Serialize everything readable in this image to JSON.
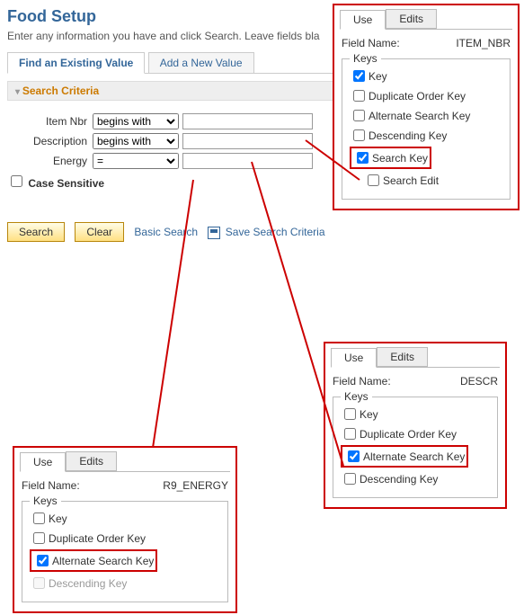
{
  "page": {
    "title": "Food Setup",
    "instruction": "Enter any information you have and click Search. Leave fields bla",
    "tabs": {
      "find": "Find an Existing Value",
      "add": "Add a New Value"
    },
    "section_bar": "Search Criteria",
    "fields": {
      "item_nbr": {
        "label": "Item Nbr",
        "op": "begins with",
        "value": ""
      },
      "description": {
        "label": "Description",
        "op": "begins with",
        "value": ""
      },
      "energy": {
        "label": "Energy",
        "op": "=",
        "value": ""
      }
    },
    "case_sensitive_label": "Case Sensitive",
    "buttons": {
      "search": "Search",
      "clear": "Clear"
    },
    "links": {
      "basic": "Basic Search",
      "save": "Save Search Criteria"
    }
  },
  "popup_common": {
    "tab_use": "Use",
    "tab_edits": "Edits",
    "field_name_label": "Field Name:",
    "keys_legend": "Keys",
    "k_key": "Key",
    "k_dup": "Duplicate Order Key",
    "k_alt": "Alternate Search Key",
    "k_desc": "Descending Key",
    "k_search": "Search Key",
    "k_searchedit": "Search Edit"
  },
  "popups": {
    "item_nbr": {
      "field_name_value": "ITEM_NBR",
      "checks": {
        "key": true,
        "dup": false,
        "alt": false,
        "desc": false,
        "search": true,
        "searchedit": false
      },
      "highlight": "search"
    },
    "descr": {
      "field_name_value": "DESCR",
      "checks": {
        "key": false,
        "dup": false,
        "alt": true,
        "desc": false
      },
      "highlight": "alt"
    },
    "energy": {
      "field_name_value": "R9_ENERGY",
      "checks": {
        "key": false,
        "dup": false,
        "alt": true,
        "desc": false
      },
      "desc_disabled": true,
      "highlight": "alt"
    }
  }
}
